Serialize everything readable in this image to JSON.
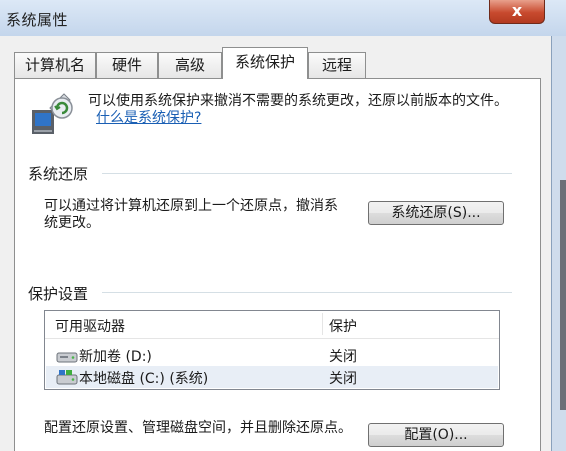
{
  "window": {
    "title": "系统属性",
    "close_label": "x"
  },
  "tabs": [
    {
      "label": "计算机名",
      "active": false
    },
    {
      "label": "硬件",
      "active": false
    },
    {
      "label": "高级",
      "active": false
    },
    {
      "label": "系统保护",
      "active": true
    },
    {
      "label": "远程",
      "active": false
    }
  ],
  "intro": {
    "text": "可以使用系统保护来撤消不需要的系统更改，还原以前版本的文件。",
    "link": "什么是系统保护?"
  },
  "restore": {
    "section_title": "系统还原",
    "description": "可以通过将计算机还原到上一个还原点，撤消系统更改。",
    "button": "系统还原(S)..."
  },
  "protection": {
    "section_title": "保护设置",
    "col_drive": "可用驱动器",
    "col_protection": "保护",
    "drives": [
      {
        "name": "新加卷 (D:)",
        "status": "关闭",
        "icon": "hard-drive-icon"
      },
      {
        "name": "本地磁盘 (C:) (系统)",
        "status": "关闭",
        "icon": "system-drive-icon"
      }
    ],
    "configure_text": "配置还原设置、管理磁盘空间，并且删除还原点。",
    "configure_button": "配置(O)..."
  }
}
